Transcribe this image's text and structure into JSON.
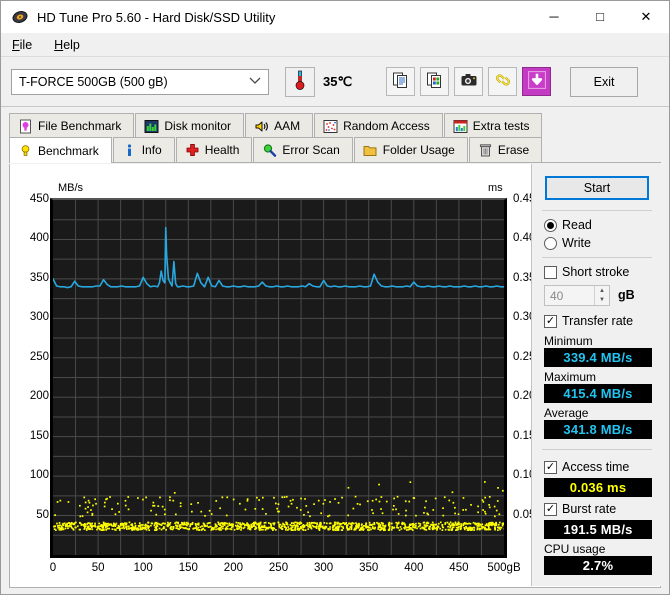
{
  "window": {
    "title": "HD Tune Pro 5.60 - Hard Disk/SSD Utility",
    "app_icon": "hard-disk-icon",
    "minimize": "─",
    "maximize": "□",
    "close": "✕"
  },
  "menu": {
    "items": [
      {
        "label": "File",
        "accel": "F"
      },
      {
        "label": "Help",
        "accel": "H"
      }
    ]
  },
  "toolbar": {
    "drive": "T-FORCE 500GB (500 gB)",
    "drive_chevron": "⌄",
    "temperature": "35℃",
    "thermometer_icon": "thermometer-icon",
    "buttons": [
      {
        "name": "copy-text-button",
        "icon": "copy-text-icon"
      },
      {
        "name": "copy-image-button",
        "icon": "copy-image-icon"
      },
      {
        "name": "screenshot-button",
        "icon": "camera-icon"
      },
      {
        "name": "link-button",
        "icon": "chain-link-icon"
      },
      {
        "name": "download-button",
        "icon": "download-arrow-icon"
      }
    ],
    "exit_label": "Exit"
  },
  "tabs": {
    "row1": [
      {
        "label": "File Benchmark",
        "icon": "magenta-bulb-page-icon",
        "active": false
      },
      {
        "label": "Disk monitor",
        "icon": "bar-chart-icon",
        "active": false
      },
      {
        "label": "AAM",
        "icon": "speaker-icon",
        "active": false
      },
      {
        "label": "Random Access",
        "icon": "scatter-icon",
        "active": false
      },
      {
        "label": "Extra tests",
        "icon": "chart-grid-icon",
        "active": false
      }
    ],
    "row2": [
      {
        "label": "Benchmark",
        "icon": "yellow-bulb-icon",
        "active": true
      },
      {
        "label": "Info",
        "icon": "info-icon",
        "active": false
      },
      {
        "label": "Health",
        "icon": "red-cross-icon",
        "active": false
      },
      {
        "label": "Error Scan",
        "icon": "magnifier-icon",
        "active": false
      },
      {
        "label": "Folder Usage",
        "icon": "folder-icon",
        "active": false
      },
      {
        "label": "Erase",
        "icon": "trash-icon",
        "active": false
      }
    ]
  },
  "panel": {
    "start_label": "Start",
    "mode": {
      "read_label": "Read",
      "write_label": "Write",
      "selected": "Read"
    },
    "short_stroke": {
      "label": "Short stroke",
      "checked": false,
      "value": "40",
      "unit": "gB"
    },
    "transfer_rate": {
      "label": "Transfer rate",
      "checked": true
    },
    "minimum": {
      "label": "Minimum",
      "value": "339.4 MB/s"
    },
    "maximum": {
      "label": "Maximum",
      "value": "415.4 MB/s"
    },
    "average": {
      "label": "Average",
      "value": "341.8 MB/s"
    },
    "access_time": {
      "label": "Access time",
      "checked": true,
      "value": "0.036 ms"
    },
    "burst_rate": {
      "label": "Burst rate",
      "checked": true,
      "value": "191.5 MB/s"
    },
    "cpu_usage": {
      "label": "CPU usage",
      "value": "2.7%"
    }
  },
  "chart_data": {
    "type": "line",
    "title": "",
    "xlabel": "",
    "ylabel": "MB/s",
    "y2label": "ms",
    "xlim": [
      0,
      500
    ],
    "ylim": [
      0,
      450
    ],
    "y2lim": [
      0,
      0.45
    ],
    "grid": true,
    "legend": "none",
    "background": "#1a1a1a",
    "grid_color": "#4a4a4a",
    "xticks": [
      0,
      50,
      100,
      150,
      200,
      250,
      300,
      350,
      400,
      450,
      500
    ],
    "xtick_labels": [
      "0",
      "50",
      "100",
      "150",
      "200",
      "250",
      "300",
      "350",
      "400",
      "450",
      "500gB"
    ],
    "yticks": [
      50,
      100,
      150,
      200,
      250,
      300,
      350,
      400,
      450
    ],
    "ytick_labels": [
      "50",
      "100",
      "150",
      "200",
      "250",
      "300",
      "350",
      "400",
      "450"
    ],
    "y2ticks": [
      0.05,
      0.1,
      0.15,
      0.2,
      0.25,
      0.3,
      0.35,
      0.4,
      0.45
    ],
    "y2tick_labels": [
      "0.05",
      "0.10",
      "0.15",
      "0.20",
      "0.25",
      "0.30",
      "0.35",
      "0.40",
      "0.45"
    ],
    "series": [
      {
        "name": "Transfer rate",
        "type": "line",
        "axis": "left",
        "color": "#29a8e0",
        "unit": "MB/s",
        "x": [
          0,
          4,
          8,
          12,
          16,
          20,
          24,
          28,
          32,
          36,
          40,
          44,
          48,
          52,
          56,
          60,
          64,
          68,
          72,
          76,
          80,
          84,
          88,
          92,
          96,
          100,
          104,
          108,
          112,
          116,
          118,
          120,
          122,
          124,
          125,
          126,
          128,
          130,
          132,
          134,
          136,
          138,
          140,
          144,
          148,
          152,
          156,
          160,
          164,
          168,
          172,
          176,
          180,
          184,
          188,
          192,
          196,
          200,
          204,
          208,
          212,
          216,
          220,
          224,
          228,
          232,
          236,
          240,
          244,
          248,
          252,
          256,
          260,
          264,
          268,
          272,
          276,
          280,
          284,
          288,
          292,
          296,
          300,
          304,
          308,
          312,
          316,
          320,
          324,
          328,
          332,
          336,
          340,
          344,
          348,
          352,
          356,
          360,
          364,
          368,
          372,
          376,
          380,
          384,
          388,
          392,
          396,
          400,
          404,
          408,
          412,
          416,
          420,
          424,
          428,
          432,
          436,
          440,
          444,
          448,
          452,
          456,
          460,
          464,
          468,
          472,
          476,
          480,
          484,
          488,
          492,
          496,
          500
        ],
        "y": [
          350,
          341,
          340,
          340,
          339,
          340,
          347,
          341,
          340,
          340,
          340,
          340,
          341,
          341,
          349,
          343,
          340,
          340,
          340,
          341,
          340,
          340,
          340,
          340,
          341,
          352,
          344,
          340,
          341,
          340,
          345,
          360,
          348,
          345,
          415,
          380,
          350,
          345,
          341,
          372,
          344,
          340,
          340,
          341,
          340,
          340,
          341,
          357,
          345,
          340,
          352,
          341,
          340,
          348,
          341,
          340,
          340,
          341,
          340,
          340,
          341,
          340,
          340,
          340,
          341,
          346,
          341,
          340,
          340,
          341,
          340,
          340,
          341,
          340,
          340,
          340,
          341,
          340,
          344,
          341,
          340,
          340,
          348,
          341,
          340,
          341,
          340,
          340,
          341,
          340,
          340,
          340,
          341,
          340,
          340,
          341,
          356,
          346,
          341,
          340,
          340,
          341,
          340,
          340,
          340,
          341,
          340,
          346,
          341,
          340,
          340,
          341,
          340,
          340,
          341,
          340,
          340,
          341,
          340,
          340,
          340,
          341,
          340,
          340,
          341,
          340,
          340,
          341,
          340,
          340,
          341,
          340,
          340
        ]
      },
      {
        "name": "Access time",
        "type": "scatter",
        "axis": "right",
        "color": "#ffff00",
        "unit": "ms",
        "baseline_ms": 0.036,
        "scatter_band_ms": [
          0.05,
          0.075
        ],
        "note": "dense yellow baseline band near 0.036 ms with scattered points between 0.05 and 0.08 ms"
      }
    ]
  }
}
